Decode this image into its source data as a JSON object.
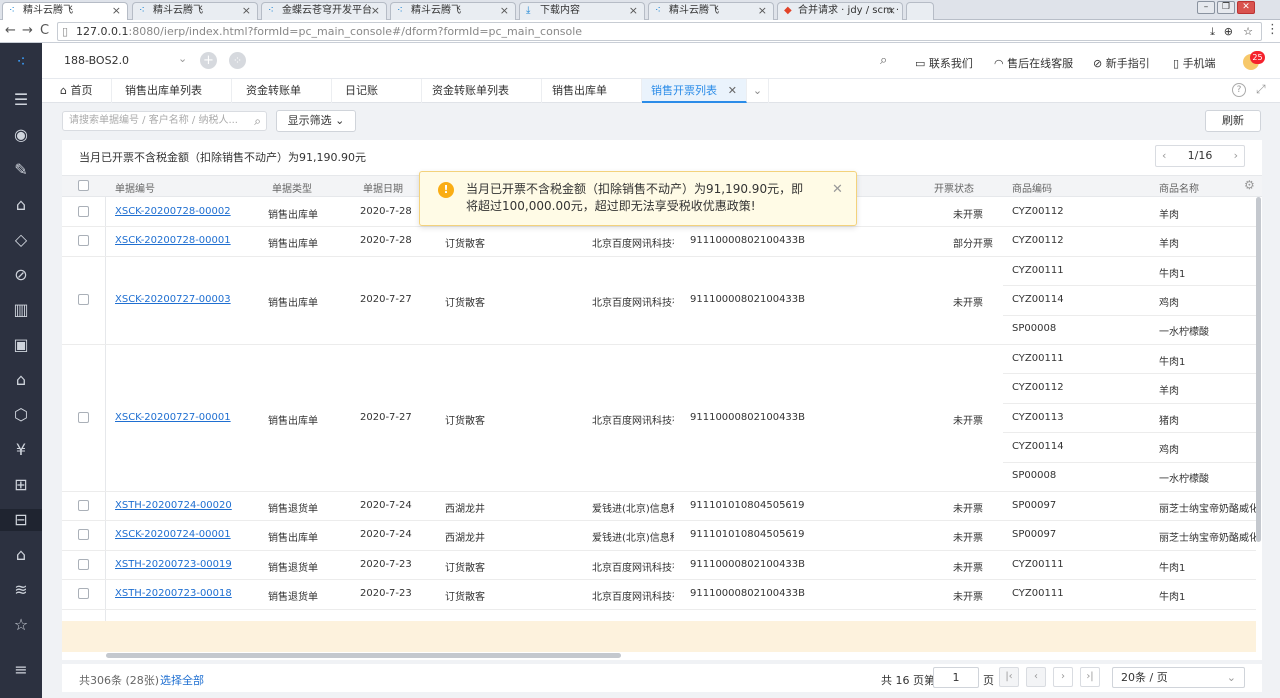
{
  "browser": {
    "tabs": [
      {
        "title": "精斗云腾飞",
        "active": true
      },
      {
        "title": "精斗云腾飞",
        "active": false
      },
      {
        "title": "金蝶云苍穹开发平台",
        "active": false
      },
      {
        "title": "精斗云腾飞",
        "active": false
      },
      {
        "title": "下载内容",
        "active": false
      },
      {
        "title": "精斗云腾飞",
        "active": false
      },
      {
        "title": "合并请求 · jdy / scm · G",
        "active": false
      }
    ],
    "url_host": "127.0.0.1",
    "url_rest": ":8080/ierp/index.html?formId=pc_main_console#/dform?formId=pc_main_console"
  },
  "header": {
    "tenant": "188-BOS2.0",
    "contact": "联系我们",
    "service": "售后在线客服",
    "guide": "新手指引",
    "mobile": "手机端",
    "badge": "25"
  },
  "module_tabs": {
    "home": "首页",
    "items": [
      "销售出库单列表",
      "资金转账单",
      "日记账",
      "资金转账单列表",
      "销售出库单",
      "销售开票列表"
    ]
  },
  "toolbar": {
    "search_placeholder": "请搜索单据编号 / 客户名称 / 纳税人...",
    "filter_label": "显示筛选",
    "refresh_label": "刷新"
  },
  "summary": "当月已开票不含税金额（扣除销售不动产）为91,190.90元",
  "pager_top": "1/16",
  "alert": {
    "message": "当月已开票不含税金额（扣除销售不动产）为91,190.90元，即将超过100,000.00元，超过即无法享受税收优惠政策!"
  },
  "table": {
    "columns": [
      "单据编号",
      "单据类型",
      "单据日期",
      "开票状态",
      "商品编码",
      "商品名称"
    ],
    "rows": [
      {
        "no": "XSCK-20200728-00002",
        "type": "销售出库单",
        "date": "2020-7-28",
        "customer": "",
        "company": "",
        "taxno": "",
        "status": "未开票",
        "items": [
          [
            "CYZ00112",
            "羊肉"
          ]
        ]
      },
      {
        "no": "XSCK-20200728-00001",
        "type": "销售出库单",
        "date": "2020-7-28",
        "customer": "订货散客",
        "company": "北京百度网讯科技有",
        "taxno": "91110000802100433B",
        "status": "部分开票",
        "items": [
          [
            "CYZ00112",
            "羊肉"
          ]
        ]
      },
      {
        "no": "XSCK-20200727-00003",
        "type": "销售出库单",
        "date": "2020-7-27",
        "customer": "订货散客",
        "company": "北京百度网讯科技有",
        "taxno": "91110000802100433B",
        "status": "未开票",
        "items": [
          [
            "CYZ00111",
            "牛肉1"
          ],
          [
            "CYZ00114",
            "鸡肉"
          ],
          [
            "SP00008",
            "一水柠檬酸"
          ]
        ]
      },
      {
        "no": "XSCK-20200727-00001",
        "type": "销售出库单",
        "date": "2020-7-27",
        "customer": "订货散客",
        "company": "北京百度网讯科技有",
        "taxno": "91110000802100433B",
        "status": "未开票",
        "items": [
          [
            "CYZ00111",
            "牛肉1"
          ],
          [
            "CYZ00112",
            "羊肉"
          ],
          [
            "CYZ00113",
            "猪肉"
          ],
          [
            "CYZ00114",
            "鸡肉"
          ],
          [
            "SP00008",
            "一水柠檬酸"
          ]
        ]
      },
      {
        "no": "XSTH-20200724-00020",
        "type": "销售退货单",
        "date": "2020-7-24",
        "customer": "西湖龙井",
        "company": "爱钱进(北京)信息科",
        "taxno": "911101010804505619",
        "status": "未开票",
        "items": [
          [
            "SP00097",
            "丽芝士纳宝帝奶酪威化饼"
          ]
        ]
      },
      {
        "no": "XSCK-20200724-00001",
        "type": "销售出库单",
        "date": "2020-7-24",
        "customer": "西湖龙井",
        "company": "爱钱进(北京)信息科",
        "taxno": "911101010804505619",
        "status": "未开票",
        "items": [
          [
            "SP00097",
            "丽芝士纳宝帝奶酪威化饼"
          ]
        ]
      },
      {
        "no": "XSTH-20200723-00019",
        "type": "销售退货单",
        "date": "2020-7-23",
        "customer": "订货散客",
        "company": "北京百度网讯科技有",
        "taxno": "91110000802100433B",
        "status": "未开票",
        "items": [
          [
            "CYZ00111",
            "牛肉1"
          ]
        ]
      },
      {
        "no": "XSTH-20200723-00018",
        "type": "销售退货单",
        "date": "2020-7-23",
        "customer": "订货散客",
        "company": "北京百度网讯科技有",
        "taxno": "91110000802100433B",
        "status": "未开票",
        "items": [
          [
            "CYZ00111",
            "牛肉1"
          ]
        ]
      }
    ]
  },
  "footer": {
    "total": "共306条 (28张)",
    "select_all": "选择全部",
    "pages_prefix": "共 16 页第",
    "page": "1",
    "pages_suffix": "页",
    "page_size": "20条 / 页"
  }
}
